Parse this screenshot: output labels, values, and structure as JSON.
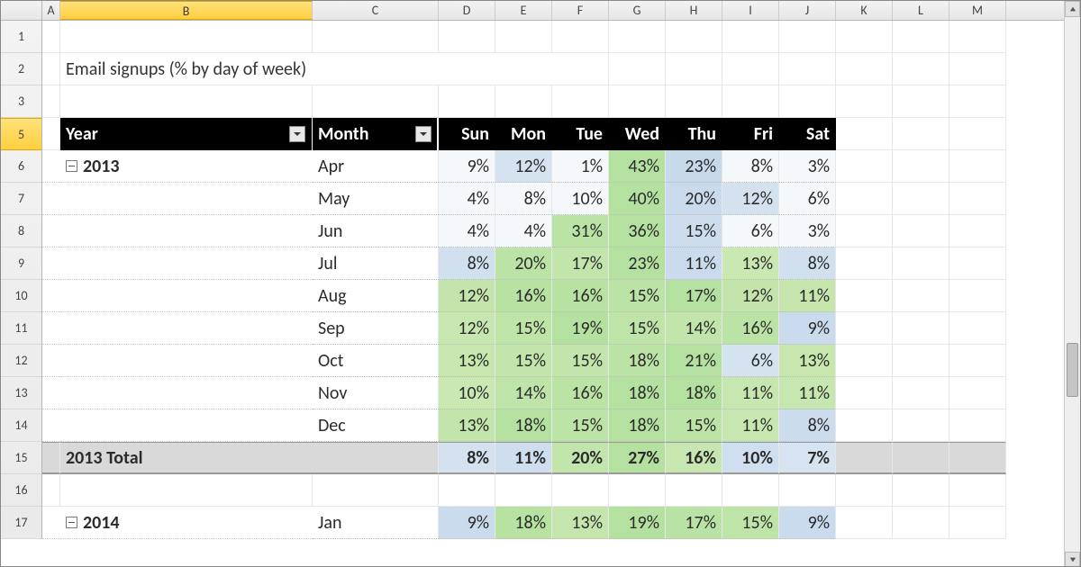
{
  "columns": [
    "A",
    "B",
    "C",
    "D",
    "E",
    "F",
    "G",
    "H",
    "I",
    "J",
    "K",
    "L",
    "M"
  ],
  "selected_column": "B",
  "col_widths": {
    "A": 20,
    "B": 280,
    "C": 140,
    "D": 63,
    "E": 63,
    "F": 63,
    "G": 63,
    "H": 63,
    "I": 63,
    "J": 63,
    "K": 63,
    "L": 63,
    "M": 63
  },
  "row_numbers": [
    1,
    2,
    3,
    5,
    6,
    7,
    8,
    9,
    10,
    11,
    12,
    13,
    14,
    15,
    16,
    17
  ],
  "selected_row": 5,
  "title": "Email signups (% by day of week)",
  "pivot": {
    "year_label": "Year",
    "month_label": "Month",
    "days": [
      "Sun",
      "Mon",
      "Tue",
      "Wed",
      "Thu",
      "Fri",
      "Sat"
    ]
  },
  "groups": [
    {
      "year": "2013",
      "rows": [
        {
          "month": "Apr",
          "vals": [
            "9%",
            "12%",
            "1%",
            "43%",
            "23%",
            "8%",
            "3%"
          ]
        },
        {
          "month": "May",
          "vals": [
            "4%",
            "8%",
            "10%",
            "40%",
            "20%",
            "12%",
            "6%"
          ]
        },
        {
          "month": "Jun",
          "vals": [
            "4%",
            "4%",
            "31%",
            "36%",
            "15%",
            "6%",
            "3%"
          ]
        },
        {
          "month": "Jul",
          "vals": [
            "8%",
            "20%",
            "17%",
            "23%",
            "11%",
            "13%",
            "8%"
          ]
        },
        {
          "month": "Aug",
          "vals": [
            "12%",
            "16%",
            "16%",
            "15%",
            "17%",
            "12%",
            "11%"
          ]
        },
        {
          "month": "Sep",
          "vals": [
            "12%",
            "15%",
            "19%",
            "15%",
            "14%",
            "16%",
            "9%"
          ]
        },
        {
          "month": "Oct",
          "vals": [
            "13%",
            "15%",
            "15%",
            "18%",
            "21%",
            "6%",
            "13%"
          ]
        },
        {
          "month": "Nov",
          "vals": [
            "10%",
            "14%",
            "16%",
            "18%",
            "18%",
            "11%",
            "11%"
          ]
        },
        {
          "month": "Dec",
          "vals": [
            "13%",
            "18%",
            "15%",
            "18%",
            "15%",
            "11%",
            "8%"
          ]
        }
      ],
      "total_label": "2013 Total",
      "total": [
        "8%",
        "11%",
        "20%",
        "27%",
        "16%",
        "10%",
        "7%"
      ]
    },
    {
      "year": "2014",
      "rows": [
        {
          "month": "Jan",
          "vals": [
            "9%",
            "18%",
            "13%",
            "19%",
            "17%",
            "15%",
            "9%"
          ]
        }
      ]
    }
  ],
  "chart_data": {
    "type": "table",
    "title": "Email signups (% by day of week)",
    "columns": [
      "Sun",
      "Mon",
      "Tue",
      "Wed",
      "Thu",
      "Fri",
      "Sat"
    ],
    "rows": [
      {
        "year": 2013,
        "month": "Apr",
        "values": [
          9,
          12,
          1,
          43,
          23,
          8,
          3
        ]
      },
      {
        "year": 2013,
        "month": "May",
        "values": [
          4,
          8,
          10,
          40,
          20,
          12,
          6
        ]
      },
      {
        "year": 2013,
        "month": "Jun",
        "values": [
          4,
          4,
          31,
          36,
          15,
          6,
          3
        ]
      },
      {
        "year": 2013,
        "month": "Jul",
        "values": [
          8,
          20,
          17,
          23,
          11,
          13,
          8
        ]
      },
      {
        "year": 2013,
        "month": "Aug",
        "values": [
          12,
          16,
          16,
          15,
          17,
          12,
          11
        ]
      },
      {
        "year": 2013,
        "month": "Sep",
        "values": [
          12,
          15,
          19,
          15,
          14,
          16,
          9
        ]
      },
      {
        "year": 2013,
        "month": "Oct",
        "values": [
          13,
          15,
          15,
          18,
          21,
          6,
          13
        ]
      },
      {
        "year": 2013,
        "month": "Nov",
        "values": [
          10,
          14,
          16,
          18,
          18,
          11,
          11
        ]
      },
      {
        "year": 2013,
        "month": "Dec",
        "values": [
          13,
          18,
          15,
          18,
          15,
          11,
          8
        ]
      },
      {
        "year": 2013,
        "month": "Total",
        "values": [
          8,
          11,
          20,
          27,
          16,
          10,
          7
        ]
      },
      {
        "year": 2014,
        "month": "Jan",
        "values": [
          9,
          18,
          13,
          19,
          17,
          15,
          9
        ]
      }
    ],
    "unit": "percent",
    "color_scale": {
      "low": "#e8eef6",
      "high": "#cbe3b2",
      "axis": "row-relative"
    }
  }
}
